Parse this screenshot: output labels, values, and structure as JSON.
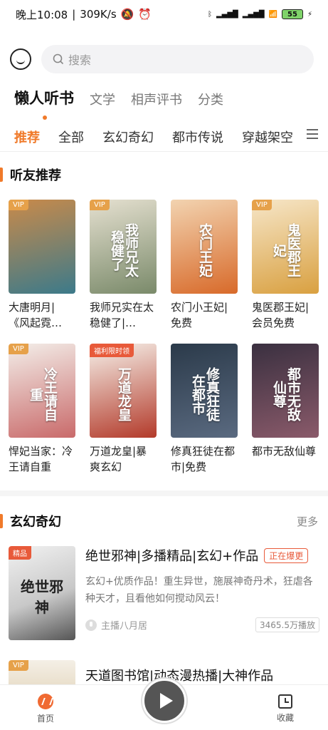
{
  "status_bar": {
    "time": "晚上10:08",
    "speed": "309K/s",
    "battery": "55"
  },
  "search": {
    "placeholder": "搜索"
  },
  "top_tabs": [
    {
      "label": "懒人听书",
      "active": true
    },
    {
      "label": "文学"
    },
    {
      "label": "相声评书"
    },
    {
      "label": "分类"
    }
  ],
  "category_tabs": [
    {
      "label": "推荐",
      "active": true
    },
    {
      "label": "全部"
    },
    {
      "label": "玄幻奇幻"
    },
    {
      "label": "都市传说"
    },
    {
      "label": "穿越架空"
    }
  ],
  "section_recommend": {
    "title": "听友推荐",
    "books": [
      {
        "title": "大唐明月|《风起霓…",
        "badge": "VIP",
        "cover_text": "",
        "cover_colors": [
          "#c98a4a",
          "#3c7a8a"
        ]
      },
      {
        "title": "我师兄实在太稳健了|…",
        "badge": "VIP",
        "cover_text": "我师兄太稳健了",
        "cover_colors": [
          "#e5e0d0",
          "#7a8a6a"
        ]
      },
      {
        "title": "农门小王妃|免费",
        "badge": "",
        "cover_text": "农门王妃",
        "cover_colors": [
          "#f2d3b0",
          "#d86a2a"
        ]
      },
      {
        "title": "鬼医郡王妃|会员免费",
        "badge": "VIP",
        "cover_text": "鬼医郡王妃",
        "cover_colors": [
          "#f6e6c8",
          "#d9a040"
        ]
      },
      {
        "title": "悍妃当家：冷王请自重",
        "badge": "VIP",
        "cover_text": "冷王请自重",
        "cover_colors": [
          "#f3eee9",
          "#c96a6a"
        ]
      },
      {
        "title": "万道龙皇|暴爽玄幻",
        "badge": "福利限时领",
        "cover_text": "万道龙皇",
        "cover_colors": [
          "#f6f1ea",
          "#b33a2a"
        ]
      },
      {
        "title": "修真狂徒在都市|免费",
        "badge": "",
        "cover_text": "修真狂徒在都市",
        "cover_colors": [
          "#2b3a4a",
          "#5a6a80"
        ]
      },
      {
        "title": "都市无敌仙尊",
        "badge": "",
        "cover_text": "都市无敌仙尊",
        "cover_colors": [
          "#3a3040",
          "#8a5a6a"
        ]
      }
    ]
  },
  "section_fantasy": {
    "title": "玄幻奇幻",
    "more": "更多",
    "items": [
      {
        "title": "绝世邪神|多播精品|玄幻+作品",
        "badge": "精品",
        "hot": "正在爆更",
        "cover_text": "绝世邪神",
        "desc": "玄幻+优质作品！重生异世，施展神奇丹术，狂虐各种天才，且看他如何搅动风云！",
        "host": "主播八月居",
        "plays": "3465.5万播放"
      },
      {
        "title": "天道图书馆|动态漫热播|大神作品",
        "badge": "VIP",
        "cover_text": ""
      }
    ]
  },
  "bottom_nav": {
    "home": "首页",
    "favorites": "收藏"
  }
}
